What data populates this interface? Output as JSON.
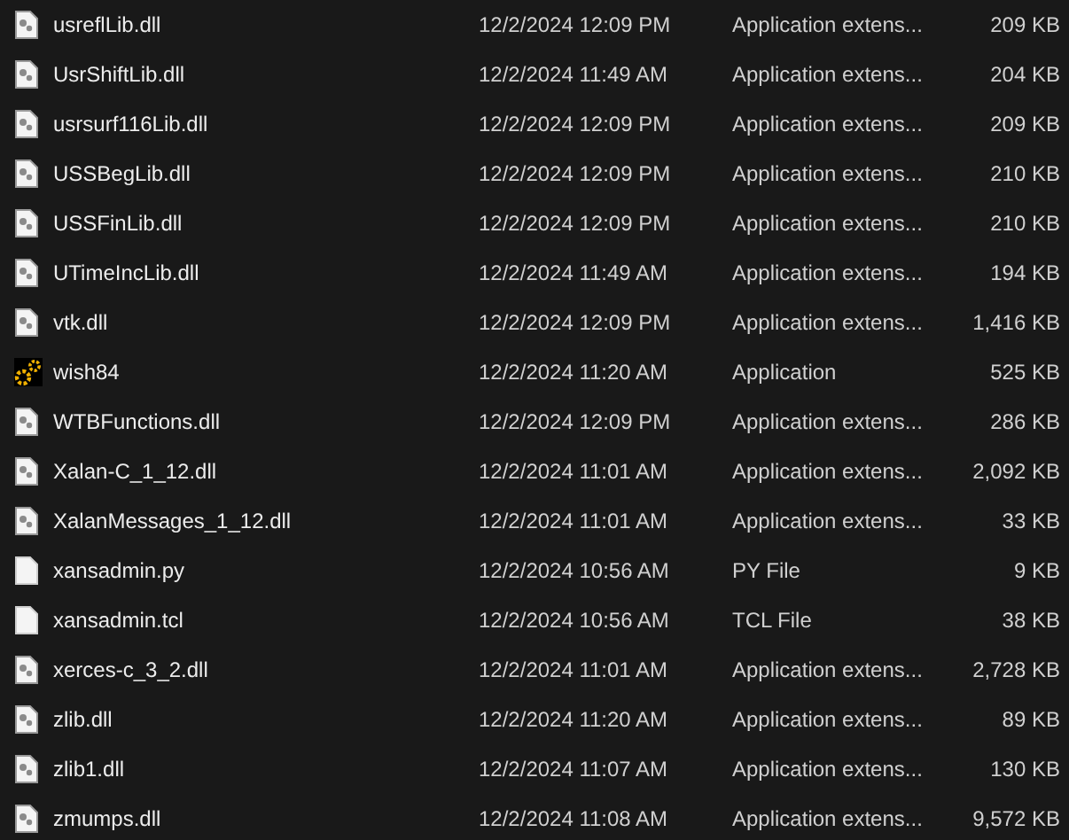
{
  "files": [
    {
      "name": "usreflLib.dll",
      "kind": "dll",
      "modified": "12/2/2024 12:09 PM",
      "type": "Application extens...",
      "size": "209 KB"
    },
    {
      "name": "UsrShiftLib.dll",
      "kind": "dll",
      "modified": "12/2/2024 11:49 AM",
      "type": "Application extens...",
      "size": "204 KB"
    },
    {
      "name": "usrsurf116Lib.dll",
      "kind": "dll",
      "modified": "12/2/2024 12:09 PM",
      "type": "Application extens...",
      "size": "209 KB"
    },
    {
      "name": "USSBegLib.dll",
      "kind": "dll",
      "modified": "12/2/2024 12:09 PM",
      "type": "Application extens...",
      "size": "210 KB"
    },
    {
      "name": "USSFinLib.dll",
      "kind": "dll",
      "modified": "12/2/2024 12:09 PM",
      "type": "Application extens...",
      "size": "210 KB"
    },
    {
      "name": "UTimeIncLib.dll",
      "kind": "dll",
      "modified": "12/2/2024 11:49 AM",
      "type": "Application extens...",
      "size": "194 KB"
    },
    {
      "name": "vtk.dll",
      "kind": "dll",
      "modified": "12/2/2024 12:09 PM",
      "type": "Application extens...",
      "size": "1,416 KB"
    },
    {
      "name": "wish84",
      "kind": "app",
      "modified": "12/2/2024 11:20 AM",
      "type": "Application",
      "size": "525 KB"
    },
    {
      "name": "WTBFunctions.dll",
      "kind": "dll",
      "modified": "12/2/2024 12:09 PM",
      "type": "Application extens...",
      "size": "286 KB"
    },
    {
      "name": "Xalan-C_1_12.dll",
      "kind": "dll",
      "modified": "12/2/2024 11:01 AM",
      "type": "Application extens...",
      "size": "2,092 KB"
    },
    {
      "name": "XalanMessages_1_12.dll",
      "kind": "dll",
      "modified": "12/2/2024 11:01 AM",
      "type": "Application extens...",
      "size": "33 KB"
    },
    {
      "name": "xansadmin.py",
      "kind": "file",
      "modified": "12/2/2024 10:56 AM",
      "type": "PY File",
      "size": "9 KB"
    },
    {
      "name": "xansadmin.tcl",
      "kind": "file",
      "modified": "12/2/2024 10:56 AM",
      "type": "TCL File",
      "size": "38 KB"
    },
    {
      "name": "xerces-c_3_2.dll",
      "kind": "dll",
      "modified": "12/2/2024 11:01 AM",
      "type": "Application extens...",
      "size": "2,728 KB"
    },
    {
      "name": "zlib.dll",
      "kind": "dll",
      "modified": "12/2/2024 11:20 AM",
      "type": "Application extens...",
      "size": "89 KB"
    },
    {
      "name": "zlib1.dll",
      "kind": "dll",
      "modified": "12/2/2024 11:07 AM",
      "type": "Application extens...",
      "size": "130 KB"
    },
    {
      "name": "zmumps.dll",
      "kind": "dll",
      "modified": "12/2/2024 11:08 AM",
      "type": "Application extens...",
      "size": "9,572 KB"
    }
  ]
}
